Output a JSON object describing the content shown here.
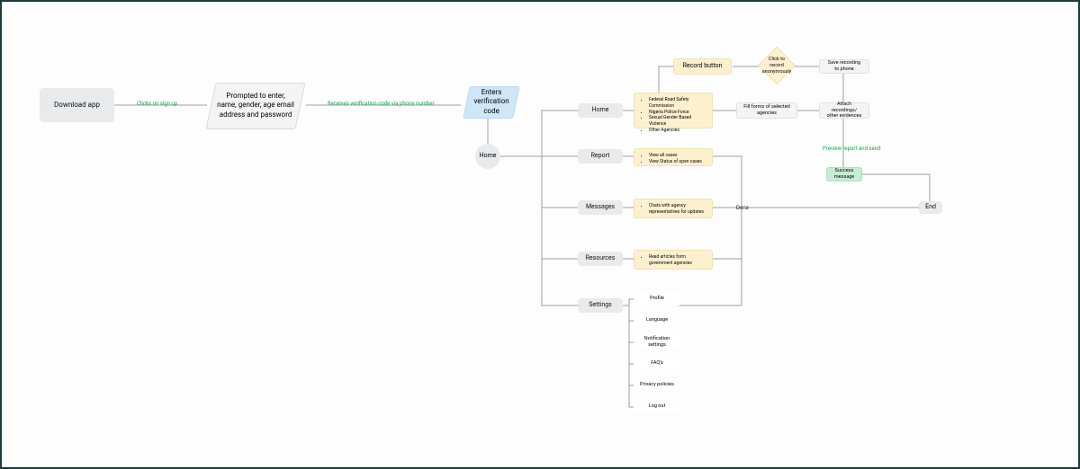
{
  "n_download": "Download app",
  "lbl_signup": "Clicks on sign up",
  "n_prompt": "Prompted to enter, name, gender, age email address and password",
  "lbl_code": "Receives verification code via phone number",
  "n_enter_code": "Enters verification code",
  "n_home": "Home",
  "tabs": {
    "home": "Home",
    "report": "Report",
    "messages": "Messages",
    "resources": "Resources",
    "settings": "Settings"
  },
  "cream_record": "Record button",
  "agencies": [
    "Federal Road Safety Commission",
    "Nigeria Police Force",
    "Sexual Gender Based Violence",
    "Other Agencies"
  ],
  "report_items": [
    "View all cases",
    "View Status of open cases"
  ],
  "messages_items": [
    "Chats with agency representatives for updates"
  ],
  "resources_items": [
    "Read articles form government agencies"
  ],
  "settings_items": [
    "Profile",
    "Language",
    "Notification settings",
    "FAQ's",
    "Privacy policies",
    "Log out"
  ],
  "diamond_text": "Click to record anonymously",
  "save_recording": "Save recording to phone",
  "fill_forms": "Fill forms of selected agencies",
  "attach": "Attach recordings/ other evidences",
  "preview": "Preview report and send",
  "success": "Success message",
  "done": "Done",
  "end": "End"
}
